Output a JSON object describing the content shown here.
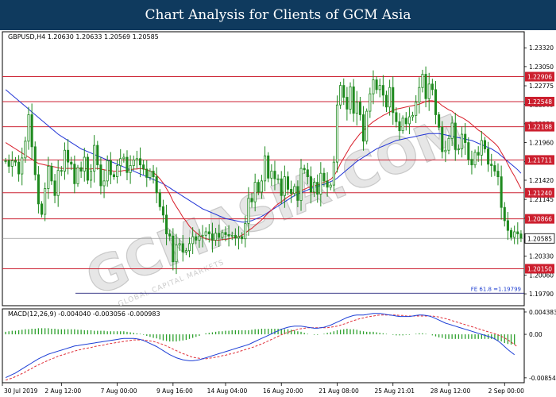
{
  "header": {
    "title": "Chart Analysis for Clients of GCM Asia"
  },
  "watermark": {
    "text": "GCMASIA.COM",
    "sub": "GLOBAL CAPITAL MARKETS"
  },
  "colors": {
    "header_bg": "#0f3a5e",
    "candle": "#1f8a1f",
    "sma_red": "#d81e2a",
    "sma_blue": "#2235d6",
    "level_line": "#cc2233",
    "level_label": "#cc1f2e",
    "macd_line": "#1e3fd6",
    "signal_line": "#e0303a",
    "histogram": "#2ca02c"
  },
  "chart_data": [
    {
      "type": "candlestick",
      "symbol_info": "GBPUSD,H4  1.20630 1.20633 1.20569 1.20585",
      "ylim": [
        1.1962,
        1.2355
      ],
      "y_ticks": [
        "1.23320",
        "1.23050",
        "1.22775",
        "1.22505",
        "1.22230",
        "1.21960",
        "1.21685",
        "1.21420",
        "1.21145",
        "1.20875",
        "1.20605",
        "1.20330",
        "1.20060",
        "1.19790"
      ],
      "levels": [
        {
          "value": 1.22906,
          "label": "1.22906"
        },
        {
          "value": 1.22548,
          "label": "1.22548"
        },
        {
          "value": 1.22188,
          "label": "1.22188"
        },
        {
          "value": 1.21711,
          "label": "1.21711"
        },
        {
          "value": 1.2124,
          "label": "1.21240"
        },
        {
          "value": 1.20866,
          "label": "1.20866"
        },
        {
          "value": 1.2015,
          "label": "1.20150"
        }
      ],
      "current_price": {
        "value": 1.20585,
        "label": "1.20585"
      },
      "fib": {
        "value": 1.19799,
        "label": "FE 61.8 =1.19799"
      },
      "close": [
        1.217,
        1.2162,
        1.217,
        1.2168,
        1.2151,
        1.2174,
        1.2198,
        1.2236,
        1.219,
        1.215,
        1.2108,
        1.2093,
        1.213,
        1.2162,
        1.2141,
        1.212,
        1.2156,
        1.2155,
        1.2185,
        1.2168,
        1.2165,
        1.2137,
        1.216,
        1.2155,
        1.2175,
        1.2142,
        1.2155,
        1.2192,
        1.2164,
        1.2134,
        1.2141,
        1.217,
        1.215,
        1.2147,
        1.2163,
        1.2173,
        1.2175,
        1.2153,
        1.2163,
        1.2171,
        1.2173,
        1.2164,
        1.2158,
        1.2146,
        1.2155,
        1.2147,
        1.2124,
        1.2104,
        1.2092,
        1.2065,
        1.2062,
        1.2025,
        1.2049,
        1.2051,
        1.2039,
        1.2041,
        1.2051,
        1.2061,
        1.2056,
        1.2062,
        1.2063,
        1.2068,
        1.2065,
        1.2056,
        1.2066,
        1.206,
        1.2067,
        1.2064,
        1.2062,
        1.2063,
        1.2059,
        1.2061,
        1.2058,
        1.208,
        1.2116,
        1.2111,
        1.2139,
        1.2125,
        1.2141,
        1.2177,
        1.2145,
        1.2155,
        1.2144,
        1.2144,
        1.212,
        1.2147,
        1.2129,
        1.2123,
        1.2133,
        1.2113,
        1.2159,
        1.2157,
        1.2147,
        1.2125,
        1.2139,
        1.2122,
        1.2152,
        1.2141,
        1.2132,
        1.2135,
        1.2168,
        1.225,
        1.2278,
        1.2261,
        1.2244,
        1.2276,
        1.2238,
        1.2254,
        1.2236,
        1.2198,
        1.2241,
        1.2266,
        1.2286,
        1.2272,
        1.2278,
        1.2264,
        1.2247,
        1.2275,
        1.2239,
        1.2226,
        1.2213,
        1.2231,
        1.2223,
        1.2233,
        1.2235,
        1.2254,
        1.2275,
        1.2294,
        1.2259,
        1.228,
        1.2272,
        1.2236,
        1.2218,
        1.2183,
        1.2185,
        1.2202,
        1.2224,
        1.2186,
        1.2187,
        1.2208,
        1.2196,
        1.2172,
        1.2164,
        1.2182,
        1.2178,
        1.2199,
        1.2187,
        1.2165,
        1.2163,
        1.2155,
        1.2147,
        1.2103,
        1.2084,
        1.207,
        1.206,
        1.2068,
        1.2065,
        1.2059
      ],
      "sma_red": [
        1.2196,
        1.2193,
        1.219,
        1.2187,
        1.2184,
        1.2181,
        1.2178,
        1.2175,
        1.2172,
        1.2169,
        1.2166,
        1.2165,
        1.2164,
        1.2163,
        1.2162,
        1.2161,
        1.216,
        1.2159,
        1.2159,
        1.2159,
        1.2159,
        1.2159,
        1.2159,
        1.2159,
        1.2159,
        1.2158,
        1.2158,
        1.2159,
        1.2159,
        1.2158,
        1.2157,
        1.2156,
        1.2156,
        1.2155,
        1.2155,
        1.2155,
        1.2156,
        1.2156,
        1.2157,
        1.2158,
        1.2158,
        1.2159,
        1.2158,
        1.2157,
        1.2155,
        1.2153,
        1.2149,
        1.2144,
        1.2138,
        1.213,
        1.2122,
        1.2112,
        1.2104,
        1.2097,
        1.2089,
        1.2083,
        1.2076,
        1.2071,
        1.2067,
        1.2063,
        1.206,
        1.2058,
        1.2057,
        1.2056,
        1.2056,
        1.2056,
        1.2057,
        1.2057,
        1.2058,
        1.2059,
        1.206,
        1.2061,
        1.2063,
        1.2066,
        1.207,
        1.2073,
        1.2077,
        1.2081,
        1.2085,
        1.209,
        1.2095,
        1.2099,
        1.2104,
        1.2108,
        1.2111,
        1.2115,
        1.2118,
        1.2121,
        1.2124,
        1.2125,
        1.2127,
        1.2129,
        1.2131,
        1.2133,
        1.2134,
        1.2135,
        1.2137,
        1.2139,
        1.2141,
        1.2143,
        1.2148,
        1.2156,
        1.2166,
        1.2174,
        1.2182,
        1.219,
        1.2197,
        1.2203,
        1.2209,
        1.2213,
        1.2218,
        1.2222,
        1.2226,
        1.2229,
        1.2232,
        1.2235,
        1.2237,
        1.224,
        1.2242,
        1.2244,
        1.2245,
        1.2246,
        1.2247,
        1.2248,
        1.2249,
        1.225,
        1.2251,
        1.2253,
        1.2255,
        1.2256,
        1.2256,
        1.2255,
        1.2253,
        1.2249,
        1.2246,
        1.2243,
        1.2241,
        1.2237,
        1.2234,
        1.2232,
        1.2229,
        1.2226,
        1.2222,
        1.2218,
        1.2214,
        1.2211,
        1.2207,
        1.2203,
        1.2199,
        1.2195,
        1.219,
        1.2182,
        1.2174,
        1.2165,
        1.2156,
        1.2148,
        1.2139,
        1.213
      ],
      "sma_blue": [
        1.2272,
        1.2268,
        1.2264,
        1.226,
        1.2256,
        1.2252,
        1.2248,
        1.2244,
        1.224,
        1.2236,
        1.2232,
        1.2228,
        1.2224,
        1.222,
        1.2216,
        1.2212,
        1.2208,
        1.2205,
        1.2202,
        1.2199,
        1.2196,
        1.2193,
        1.219,
        1.2187,
        1.2185,
        1.2183,
        1.2181,
        1.2179,
        1.2177,
        1.2175,
        1.2173,
        1.2171,
        1.2169,
        1.2167,
        1.2165,
        1.2163,
        1.2161,
        1.2159,
        1.2157,
        1.2155,
        1.2153,
        1.2151,
        1.2149,
        1.2147,
        1.2145,
        1.2143,
        1.2141,
        1.2139,
        1.2137,
        1.2134,
        1.2131,
        1.2128,
        1.2125,
        1.2122,
        1.2119,
        1.2116,
        1.2113,
        1.211,
        1.2107,
        1.2104,
        1.2101,
        1.2099,
        1.2097,
        1.2095,
        1.2093,
        1.2091,
        1.2089,
        1.2087,
        1.2086,
        1.2085,
        1.2084,
        1.2083,
        1.2082,
        1.2082,
        1.2083,
        1.2084,
        1.2086,
        1.2088,
        1.209,
        1.2093,
        1.2096,
        1.2099,
        1.2102,
        1.2105,
        1.2108,
        1.2111,
        1.2114,
        1.2117,
        1.212,
        1.2122,
        1.2124,
        1.2126,
        1.2128,
        1.213,
        1.2132,
        1.2133,
        1.2135,
        1.2136,
        1.2138,
        1.214,
        1.2142,
        1.2145,
        1.2149,
        1.2153,
        1.2157,
        1.2161,
        1.2165,
        1.2169,
        1.2172,
        1.2175,
        1.2178,
        1.2181,
        1.2184,
        1.2187,
        1.2189,
        1.2191,
        1.2193,
        1.2195,
        1.2197,
        1.2199,
        1.22,
        1.2201,
        1.2202,
        1.2203,
        1.2204,
        1.2205,
        1.2206,
        1.2207,
        1.2208,
        1.2209,
        1.2209,
        1.2209,
        1.2209,
        1.2208,
        1.2207,
        1.2206,
        1.2205,
        1.2204,
        1.2203,
        1.2202,
        1.2201,
        1.22,
        1.2199,
        1.2197,
        1.2195,
        1.2193,
        1.2191,
        1.2189,
        1.2187,
        1.2184,
        1.2181,
        1.2177,
        1.2173,
        1.2169,
        1.2165,
        1.2161,
        1.2157,
        1.2152
      ]
    },
    {
      "type": "macd",
      "title": "MACD(12,26,9) -0.004040 -0.003056 -0.000983",
      "ylim": [
        -0.0095,
        0.005
      ],
      "y_ticks": [
        {
          "value": 0.004383,
          "label": "0.004383"
        },
        {
          "value": 0.0,
          "label": "0.00"
        },
        {
          "value": -0.008543,
          "label": "-0.008543"
        }
      ],
      "macd": [
        -0.0085,
        -0.0082,
        -0.0079,
        -0.0076,
        -0.0072,
        -0.0068,
        -0.0064,
        -0.006,
        -0.0056,
        -0.0052,
        -0.0048,
        -0.0045,
        -0.0042,
        -0.0039,
        -0.0037,
        -0.0035,
        -0.0033,
        -0.0031,
        -0.0029,
        -0.0027,
        -0.0025,
        -0.0023,
        -0.0022,
        -0.0021,
        -0.002,
        -0.0019,
        -0.0018,
        -0.0017,
        -0.0016,
        -0.0015,
        -0.0014,
        -0.0013,
        -0.0012,
        -0.0011,
        -0.001,
        -0.0009,
        -0.0008,
        -0.0008,
        -0.0008,
        -0.0008,
        -0.0009,
        -0.001,
        -0.0012,
        -0.0015,
        -0.0018,
        -0.0021,
        -0.0024,
        -0.0028,
        -0.0032,
        -0.0036,
        -0.004,
        -0.0043,
        -0.0046,
        -0.0048,
        -0.005,
        -0.0051,
        -0.0052,
        -0.0052,
        -0.0051,
        -0.005,
        -0.0048,
        -0.0046,
        -0.0044,
        -0.0042,
        -0.004,
        -0.0038,
        -0.0036,
        -0.0034,
        -0.0032,
        -0.003,
        -0.0028,
        -0.0026,
        -0.0024,
        -0.0022,
        -0.002,
        -0.0017,
        -0.0014,
        -0.0011,
        -0.0008,
        -0.0005,
        -0.0002,
        0.0001,
        0.0004,
        0.0007,
        0.001,
        0.0012,
        0.0014,
        0.0015,
        0.0016,
        0.0016,
        0.0016,
        0.0015,
        0.0014,
        0.0013,
        0.0012,
        0.0012,
        0.0013,
        0.0014,
        0.0016,
        0.0018,
        0.0021,
        0.0024,
        0.0027,
        0.003,
        0.0033,
        0.0035,
        0.0037,
        0.0038,
        0.0038,
        0.0038,
        0.0039,
        0.004,
        0.0041,
        0.0041,
        0.0041,
        0.004,
        0.0039,
        0.0038,
        0.0037,
        0.0036,
        0.0035,
        0.0035,
        0.0035,
        0.0035,
        0.0036,
        0.0037,
        0.0038,
        0.0038,
        0.0037,
        0.0036,
        0.0034,
        0.0031,
        0.0028,
        0.0025,
        0.0022,
        0.002,
        0.0018,
        0.0016,
        0.0014,
        0.0012,
        0.001,
        0.0008,
        0.0006,
        0.0004,
        0.0002,
        0.0,
        -0.0002,
        -0.0004,
        -0.0006,
        -0.0009,
        -0.0013,
        -0.0018,
        -0.0024,
        -0.003,
        -0.0035,
        -0.004
      ],
      "signal": [
        -0.009,
        -0.0088,
        -0.0086,
        -0.0083,
        -0.008,
        -0.0077,
        -0.0074,
        -0.007,
        -0.0067,
        -0.0063,
        -0.006,
        -0.0057,
        -0.0054,
        -0.0051,
        -0.0048,
        -0.0046,
        -0.0043,
        -0.0041,
        -0.0039,
        -0.0037,
        -0.0035,
        -0.0033,
        -0.0031,
        -0.003,
        -0.0028,
        -0.0027,
        -0.0026,
        -0.0024,
        -0.0023,
        -0.0022,
        -0.0021,
        -0.0019,
        -0.0018,
        -0.0017,
        -0.0016,
        -0.0015,
        -0.0014,
        -0.0013,
        -0.0012,
        -0.0011,
        -0.0011,
        -0.0011,
        -0.0011,
        -0.0012,
        -0.0013,
        -0.0014,
        -0.0016,
        -0.0018,
        -0.002,
        -0.0023,
        -0.0026,
        -0.0029,
        -0.0032,
        -0.0035,
        -0.0038,
        -0.004,
        -0.0043,
        -0.0045,
        -0.0046,
        -0.0047,
        -0.0048,
        -0.0048,
        -0.0047,
        -0.0046,
        -0.0045,
        -0.0044,
        -0.0042,
        -0.0041,
        -0.0039,
        -0.0038,
        -0.0036,
        -0.0034,
        -0.0032,
        -0.003,
        -0.0028,
        -0.0026,
        -0.0024,
        -0.0021,
        -0.0019,
        -0.0016,
        -0.0013,
        -0.001,
        -0.0007,
        -0.0004,
        -0.0001,
        0.0002,
        0.0004,
        0.0006,
        0.0008,
        0.001,
        0.0011,
        0.0012,
        0.0013,
        0.0013,
        0.0013,
        0.0013,
        0.0013,
        0.0013,
        0.0013,
        0.0014,
        0.0015,
        0.0016,
        0.0018,
        0.002,
        0.0022,
        0.0025,
        0.0027,
        0.0029,
        0.0031,
        0.0032,
        0.0034,
        0.0035,
        0.0036,
        0.0037,
        0.0038,
        0.0038,
        0.0038,
        0.0038,
        0.0038,
        0.0038,
        0.0037,
        0.0037,
        0.0036,
        0.0036,
        0.0036,
        0.0036,
        0.0036,
        0.0036,
        0.0036,
        0.0036,
        0.0036,
        0.0035,
        0.0034,
        0.0032,
        0.0031,
        0.0029,
        0.0027,
        0.0025,
        0.0023,
        0.0021,
        0.0019,
        0.0017,
        0.0015,
        0.0013,
        0.0011,
        0.0009,
        0.0007,
        0.0005,
        0.0003,
        0.0001,
        -0.0001,
        -0.0004,
        -0.0007,
        -0.0011,
        -0.0015,
        -0.002,
        -0.0025
      ],
      "x_ticks": [
        "30 Jul 2019",
        "2 Aug 12:00",
        "7 Aug 00:00",
        "9 Aug 16:00",
        "14 Aug 04:00",
        "16 Aug 20:00",
        "21 Aug 08:00",
        "25 Aug 21:01",
        "28 Aug 12:00",
        "2 Sep 00:00"
      ]
    }
  ]
}
